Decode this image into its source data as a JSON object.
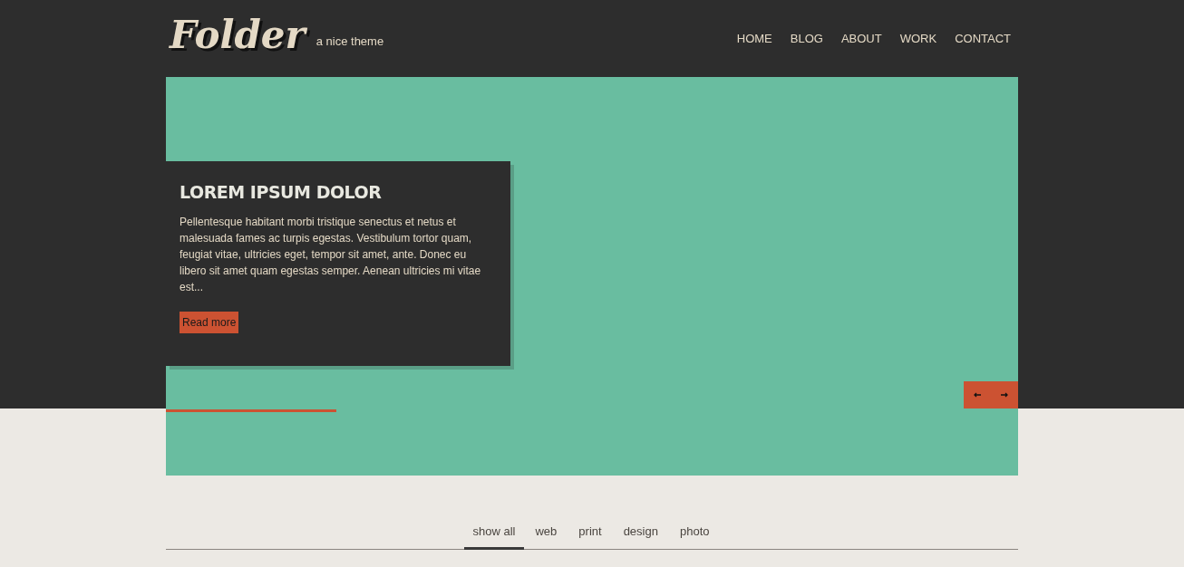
{
  "logo": {
    "title": "Folder",
    "tagline": "a nice theme"
  },
  "nav": [
    {
      "label": "HOME"
    },
    {
      "label": "BLOG"
    },
    {
      "label": "ABOUT"
    },
    {
      "label": "WORK"
    },
    {
      "label": "CONTACT"
    }
  ],
  "slider": {
    "caption_title": "LOREM IPSUM DOLOR",
    "caption_text": "Pellentesque habitant morbi tristique senectus et netus et malesuada fames ac turpis egestas. Vestibulum tortor quam, feugiat vitae, ultricies eget, tempor sit amet, ante. Donec eu libero sit amet quam egestas semper. Aenean ultricies mi vitae est...",
    "button": "Read more",
    "progress": {
      "level": 0.2
    }
  },
  "filters": [
    {
      "label": "show all",
      "selected": true
    },
    {
      "label": "web",
      "selected": false
    },
    {
      "label": "print",
      "selected": false
    },
    {
      "label": "design",
      "selected": false
    },
    {
      "label": "photo",
      "selected": false
    }
  ]
}
